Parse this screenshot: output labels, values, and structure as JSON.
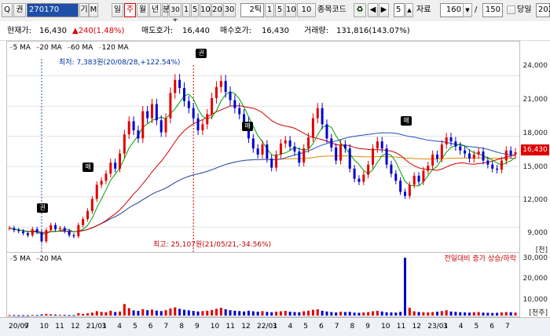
{
  "toolbar": {
    "search_prefix": "Q",
    "search_type": "권",
    "stock_code": "270170",
    "stock_name_flag": "기",
    "m_label": "M",
    "period_tabs": [
      "일",
      "주",
      "월",
      "년",
      "분"
    ],
    "active_period": "주",
    "minute_options": [
      "30초",
      "1",
      "5",
      "10",
      "20",
      "30"
    ],
    "tick_label": "2틱",
    "tick_options": [
      "1",
      "5",
      "10",
      "10"
    ],
    "code_label": "종목코드",
    "step_value": "5",
    "data_label": "자료",
    "data_count": "160",
    "slash_value": "150",
    "today_label": "당일",
    "year_value": "202"
  },
  "info": {
    "price_label": "현재가:",
    "price_value": "16,430",
    "change_value": "▲240(1.48%)",
    "ask_label": "매도호가:",
    "ask_value": "16,440",
    "bid_label": "매수호가:",
    "bid_value": "16,430",
    "volume_label": "거래량:",
    "volume_value": "131,816(143.07%)"
  },
  "legend": {
    "ma5": "5 MA",
    "ma20": "20 MA",
    "ma60": "60 MA",
    "ma120": "120 MA",
    "vol_ma5": "5 MA",
    "vol_ma20": "20 MA",
    "vol_note": "전일대비 증가 상승/하락"
  },
  "annotations": {
    "low": "최저: 7,383원(20/08/28,+122.54%)",
    "high": "최고: 25,107원(21/05/21,-34.56%)",
    "marker_right": "권",
    "marker_buy": "매",
    "marker_sell": "매"
  },
  "price_axis": [
    "24,000",
    "21,000",
    "18,000",
    "15,000",
    "12,000",
    "9,000"
  ],
  "current_price_tag": "16,430",
  "vol_axis": {
    "unit": "[천]",
    "ticks": [
      "30,000",
      "20,000",
      "10,000"
    ],
    "bottom_unit": "[천주]"
  },
  "x_axis": [
    "20/07",
    "9",
    "10",
    "11",
    "12",
    "21/01",
    "3",
    "4",
    "5",
    "6",
    "7",
    "8",
    "9",
    "10",
    "11",
    "12",
    "22/01",
    "3",
    "4",
    "5",
    "6",
    "7",
    "8",
    "9",
    "10",
    "11",
    "12",
    "23/01",
    "3",
    "4",
    "5",
    "6",
    "7"
  ],
  "colors": {
    "up": "#e00000",
    "down": "#0000cc",
    "ma5": "#00a000",
    "ma20": "#d00000",
    "ma60": "#2050c0",
    "ma120": "#e08800"
  },
  "chart_data": {
    "type": "candlestick",
    "ylim": [
      7000,
      26000
    ],
    "close": [
      8900,
      8700,
      8600,
      8400,
      8200,
      8800,
      8500,
      7600,
      8700,
      9200,
      8800,
      8900,
      8600,
      8200,
      8100,
      9200,
      9800,
      10600,
      11800,
      13200,
      13600,
      14300,
      15400,
      14800,
      16300,
      18200,
      19500,
      18600,
      17800,
      20500,
      19800,
      21200,
      19600,
      18400,
      19800,
      22300,
      23600,
      22800,
      21500,
      20800,
      19800,
      18600,
      19200,
      20200,
      21800,
      22900,
      23500,
      22400,
      21600,
      20800,
      20200,
      19400,
      17800,
      16800,
      16200,
      17200,
      15800,
      14900,
      16200,
      17300,
      17600,
      17000,
      16500,
      15400,
      16800,
      17900,
      19800,
      20800,
      19200,
      17800,
      16900,
      15600,
      17200,
      16800,
      14800,
      13800,
      13500,
      14200,
      15200,
      16800,
      17500,
      16800,
      15200,
      14300,
      13600,
      12500,
      12100,
      13200,
      14100,
      13500,
      14600,
      15100,
      16200,
      15800,
      17200,
      17900,
      17500,
      17000,
      16600,
      16300,
      15800,
      16200,
      16500,
      15600,
      15200,
      14800,
      14700,
      15600,
      16600,
      16200,
      16430
    ],
    "volume": [
      300,
      250,
      220,
      200,
      180,
      400,
      300,
      600,
      900,
      700,
      500,
      400,
      350,
      300,
      250,
      1300,
      900,
      1200,
      1600,
      2400,
      2000,
      1800,
      2600,
      1900,
      2200,
      6200,
      4000,
      2800,
      2500,
      3400,
      2900,
      3200,
      2700,
      2400,
      2900,
      3800,
      4400,
      3600,
      3100,
      2800,
      2500,
      2200,
      2400,
      2600,
      3000,
      3600,
      4200,
      3400,
      2900,
      2600,
      2400,
      2200,
      2600,
      2300,
      2100,
      2400,
      2000,
      1800,
      2100,
      2300,
      2500,
      2100,
      1900,
      1800,
      2300,
      2600,
      3100,
      3400,
      2600,
      2200,
      1900,
      1700,
      2100,
      1900,
      2000,
      1600,
      1500,
      1700,
      1900,
      2300,
      2600,
      2200,
      1800,
      1700,
      1600,
      2000,
      31000,
      4200,
      2300,
      1900,
      1800,
      1700,
      1900,
      2100,
      2400,
      2900,
      2200,
      2000,
      1800,
      1700,
      1600,
      1800,
      1900,
      1600,
      1500,
      1400,
      1500,
      1700,
      1900,
      1800,
      1600
    ]
  }
}
